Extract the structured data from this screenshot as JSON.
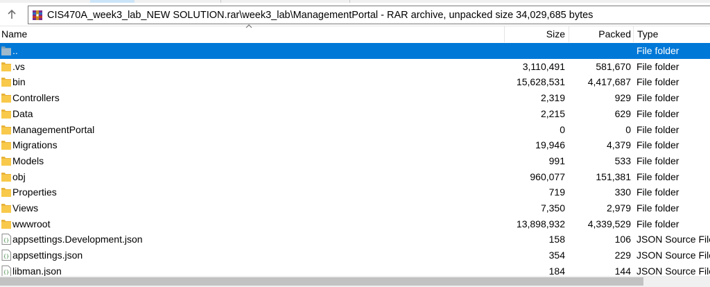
{
  "address": {
    "path": "CIS470A_week3_lab_NEW SOLUTION.rar\\week3_lab\\ManagementPortal - RAR archive, unpacked size 34,029,685 bytes"
  },
  "columns": {
    "name": "Name",
    "size": "Size",
    "packed": "Packed",
    "type": "Type"
  },
  "rows": [
    {
      "name": "..",
      "size": "",
      "packed": "",
      "type": "File folder",
      "icon": "parent-folder-icon",
      "selected": true
    },
    {
      "name": ".vs",
      "size": "3,110,491",
      "packed": "581,670",
      "type": "File folder",
      "icon": "folder-icon"
    },
    {
      "name": "bin",
      "size": "15,628,531",
      "packed": "4,417,687",
      "type": "File folder",
      "icon": "folder-icon"
    },
    {
      "name": "Controllers",
      "size": "2,319",
      "packed": "929",
      "type": "File folder",
      "icon": "folder-icon"
    },
    {
      "name": "Data",
      "size": "2,215",
      "packed": "629",
      "type": "File folder",
      "icon": "folder-icon"
    },
    {
      "name": "ManagementPortal",
      "size": "0",
      "packed": "0",
      "type": "File folder",
      "icon": "folder-icon"
    },
    {
      "name": "Migrations",
      "size": "19,946",
      "packed": "4,379",
      "type": "File folder",
      "icon": "folder-icon"
    },
    {
      "name": "Models",
      "size": "991",
      "packed": "533",
      "type": "File folder",
      "icon": "folder-icon"
    },
    {
      "name": "obj",
      "size": "960,077",
      "packed": "151,381",
      "type": "File folder",
      "icon": "folder-icon"
    },
    {
      "name": "Properties",
      "size": "719",
      "packed": "330",
      "type": "File folder",
      "icon": "folder-icon"
    },
    {
      "name": "Views",
      "size": "7,350",
      "packed": "2,979",
      "type": "File folder",
      "icon": "folder-icon"
    },
    {
      "name": "wwwroot",
      "size": "13,898,932",
      "packed": "4,339,529",
      "type": "File folder",
      "icon": "folder-icon"
    },
    {
      "name": "appsettings.Development.json",
      "size": "158",
      "packed": "106",
      "type": "JSON Source File",
      "icon": "json-file-icon"
    },
    {
      "name": "appsettings.json",
      "size": "354",
      "packed": "229",
      "type": "JSON Source File",
      "icon": "json-file-icon"
    },
    {
      "name": "libman.json",
      "size": "184",
      "packed": "144",
      "type": "JSON Source File",
      "icon": "json-file-icon"
    }
  ],
  "colors": {
    "selection": "#0078d7",
    "folder": "#f8c94a"
  }
}
